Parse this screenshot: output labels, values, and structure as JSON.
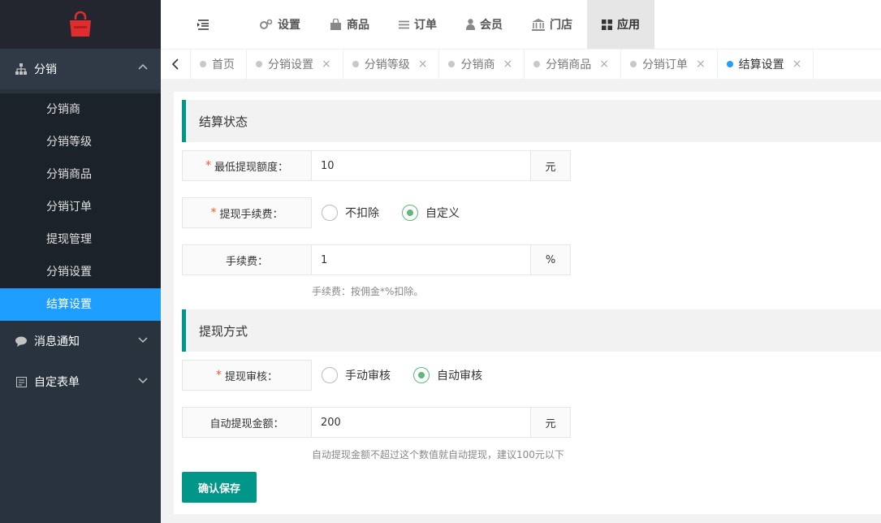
{
  "brand": {
    "logo_icon": "shopping-bag-icon",
    "logo_color": "#e02d2d"
  },
  "sidebar": {
    "groups": [
      {
        "label": "分销",
        "icon": "sitemap-icon",
        "expanded": true,
        "items": [
          {
            "label": "分销商"
          },
          {
            "label": "分销等级"
          },
          {
            "label": "分销商品"
          },
          {
            "label": "分销订单"
          },
          {
            "label": "提现管理"
          },
          {
            "label": "分销设置"
          },
          {
            "label": "结算设置",
            "active": true
          }
        ]
      },
      {
        "label": "消息通知",
        "icon": "chat-bubble-icon",
        "expanded": false
      },
      {
        "label": "自定表单",
        "icon": "form-icon",
        "expanded": false
      }
    ]
  },
  "topnav": {
    "items": [
      {
        "label": "设置",
        "icon": "gears-icon"
      },
      {
        "label": "商品",
        "icon": "shopping-bag-icon"
      },
      {
        "label": "订单",
        "icon": "list-icon"
      },
      {
        "label": "会员",
        "icon": "user-icon"
      },
      {
        "label": "门店",
        "icon": "bank-icon"
      },
      {
        "label": "应用",
        "icon": "grid-icon",
        "active": true
      }
    ]
  },
  "tabs": [
    {
      "label": "首页",
      "closable": false
    },
    {
      "label": "分销设置",
      "closable": true
    },
    {
      "label": "分销等级",
      "closable": true
    },
    {
      "label": "分销商",
      "closable": true
    },
    {
      "label": "分销商品",
      "closable": true
    },
    {
      "label": "分销订单",
      "closable": true
    },
    {
      "label": "结算设置",
      "closable": true,
      "active": true
    }
  ],
  "accent": "#009688",
  "active_blue": "#1e9fff",
  "form": {
    "section1_title": "结算状态",
    "min_withdraw": {
      "label": "最低提现额度：",
      "value": "10",
      "suffix": "元"
    },
    "fee_type": {
      "label": "提现手续费：",
      "options": [
        "不扣除",
        "自定义"
      ],
      "selected": "自定义"
    },
    "fee": {
      "label": "手续费：",
      "value": "1",
      "suffix": "%",
      "hint": "手续费：按佣金*%扣除。"
    },
    "section2_title": "提现方式",
    "review": {
      "label": "提现审核：",
      "options": [
        "手动审核",
        "自动审核"
      ],
      "selected": "自动审核"
    },
    "auto_amount": {
      "label": "自动提现金额：",
      "value": "200",
      "suffix": "元",
      "hint": "自动提现金额不超过这个数值就自动提现，建议100元以下"
    },
    "save_label": "确认保存"
  }
}
